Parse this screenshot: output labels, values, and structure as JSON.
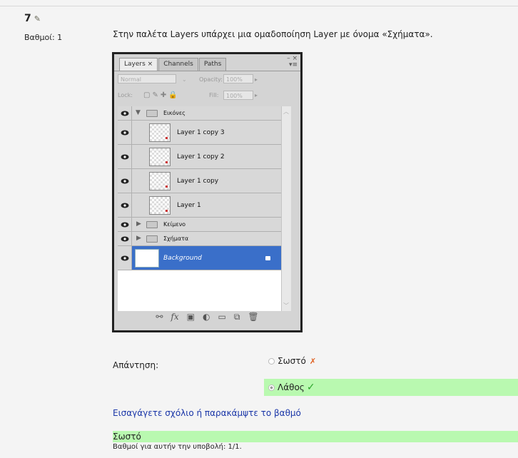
{
  "question": {
    "number": "7",
    "marks": "Βαθμοί: 1",
    "text": "Στην παλέτα Layers υπάρχει μια ομαδοποίηση Layer με όνομα «Σχήματα»."
  },
  "panel": {
    "tabs": [
      "Layers ×",
      "Channels",
      "Paths"
    ],
    "blend_mode": "Normal",
    "opacity_label": "Opacity:",
    "opacity_value": "100%",
    "lock_label": "Lock:",
    "fill_label": "Fill:",
    "fill_value": "100%",
    "layers": [
      {
        "name": "Εικόνες",
        "kind": "group-open"
      },
      {
        "name": "Layer 1 copy 3",
        "kind": "layer"
      },
      {
        "name": "Layer 1 copy 2",
        "kind": "layer"
      },
      {
        "name": "Layer 1 copy",
        "kind": "layer"
      },
      {
        "name": "Layer 1",
        "kind": "layer"
      },
      {
        "name": "Κείμενο",
        "kind": "group"
      },
      {
        "name": "Σχήματα",
        "kind": "group"
      },
      {
        "name": "Background",
        "kind": "background",
        "selected": true
      }
    ]
  },
  "answer": {
    "label": "Απάντηση:",
    "options": [
      {
        "label": "Σωστό",
        "selected": false,
        "mark": "✗"
      },
      {
        "label": "Λάθος",
        "selected": true,
        "mark": "✓"
      }
    ]
  },
  "comment_link": "Εισαγάγετε σχόλιο ή παρακάμψτε το βαθμό",
  "feedback": "Σωστό",
  "grade_line": "Βαθμοί για αυτήν την υποβολή: 1/1.",
  "colors": {
    "correct_bg": "#b9f9b0",
    "link": "#1a36a8",
    "selection": "#3a6fc9"
  }
}
